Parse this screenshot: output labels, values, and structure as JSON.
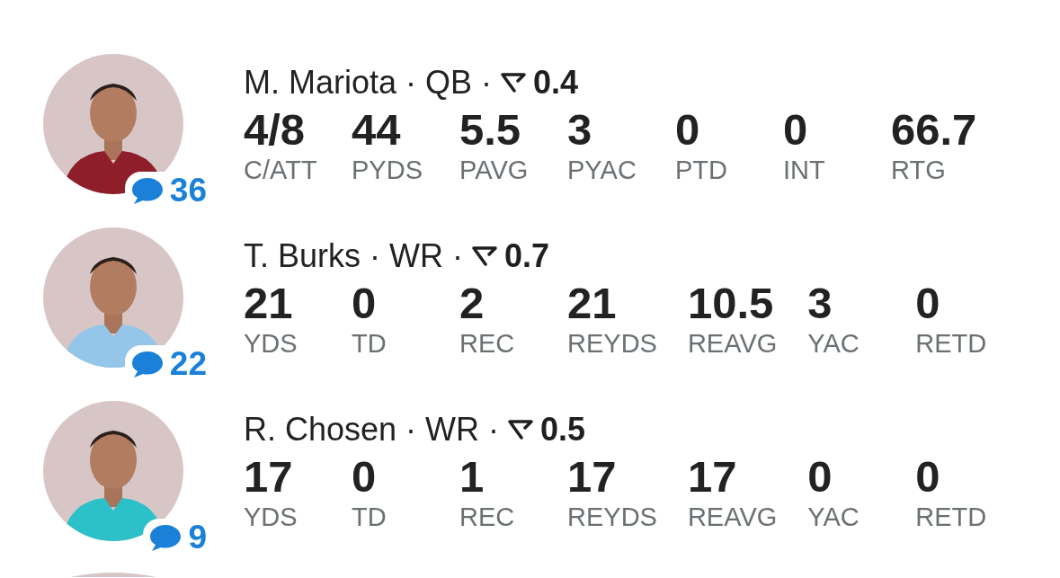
{
  "players": [
    {
      "title": "M. Mariota · QB ·",
      "score": "0.4",
      "comments": "36",
      "stats": [
        {
          "value": "4/8",
          "label": "C/ATT"
        },
        {
          "value": "44",
          "label": "PYDS"
        },
        {
          "value": "5.5",
          "label": "PAVG"
        },
        {
          "value": "3",
          "label": "PYAC"
        },
        {
          "value": "0",
          "label": "PTD"
        },
        {
          "value": "0",
          "label": "INT"
        },
        {
          "value": "66.7",
          "label": "RTG"
        }
      ]
    },
    {
      "title": "T. Burks · WR ·",
      "score": "0.7",
      "comments": "22",
      "stats": [
        {
          "value": "21",
          "label": "YDS"
        },
        {
          "value": "0",
          "label": "TD"
        },
        {
          "value": "2",
          "label": "REC"
        },
        {
          "value": "21",
          "label": "REYDS"
        },
        {
          "value": "10.5",
          "label": "REAVG"
        },
        {
          "value": "3",
          "label": "YAC"
        },
        {
          "value": "0",
          "label": "RETD"
        }
      ]
    },
    {
      "title": "R. Chosen · WR ·",
      "score": "0.5",
      "comments": "9",
      "stats": [
        {
          "value": "17",
          "label": "YDS"
        },
        {
          "value": "0",
          "label": "TD"
        },
        {
          "value": "1",
          "label": "REC"
        },
        {
          "value": "17",
          "label": "REYDS"
        },
        {
          "value": "17",
          "label": "REAVG"
        },
        {
          "value": "0",
          "label": "YAC"
        },
        {
          "value": "0",
          "label": "RETD"
        }
      ]
    }
  ]
}
